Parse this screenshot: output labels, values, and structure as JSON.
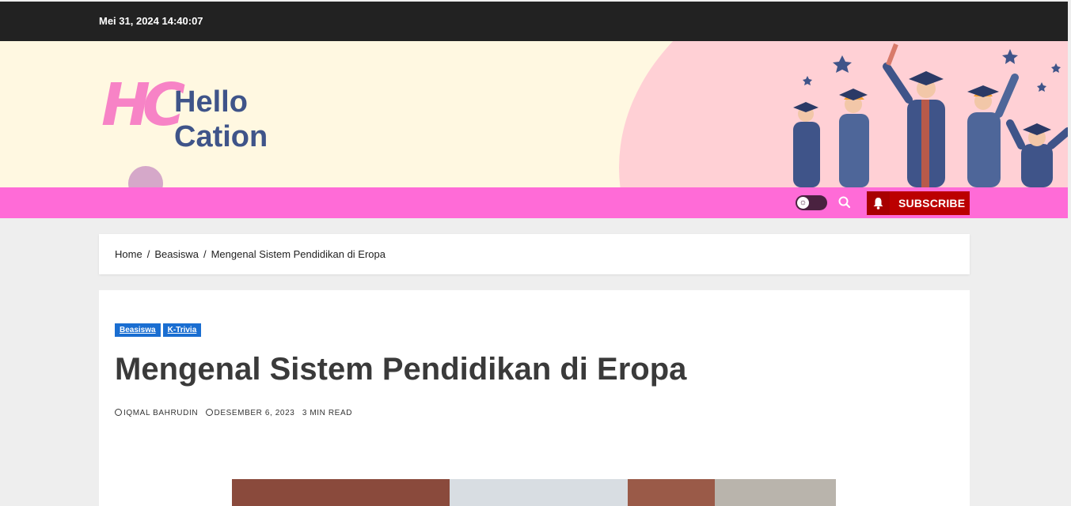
{
  "topbar": {
    "datetime": "Mei 31, 2024 14:40:07"
  },
  "logo": {
    "mark": "HC",
    "line1": "Hello",
    "line2": "Cation"
  },
  "nav": {
    "subscribe_label": "SUBSCRIBE",
    "search_icon": "search-icon",
    "theme_icon": "sun-icon"
  },
  "breadcrumb": {
    "items": [
      "Home",
      "Beasiswa",
      "Mengenal Sistem Pendidikan di Eropa"
    ],
    "separator": "/"
  },
  "article": {
    "tags": [
      "Beasiswa",
      "K-Trivia"
    ],
    "title": "Mengenal Sistem Pendidikan di Eropa",
    "author": "IQMAL BAHRUDIN",
    "date": "DESEMBER 6, 2023",
    "read_time": "3 MIN READ"
  },
  "colors": {
    "topbar": "#222222",
    "header_bg": "#fff8e1",
    "nav": "#ff6bd7",
    "subscribe": "#bb0000",
    "tag": "#1a6ed1",
    "logo_pink": "#f783c6",
    "logo_navy": "#3f5489"
  }
}
